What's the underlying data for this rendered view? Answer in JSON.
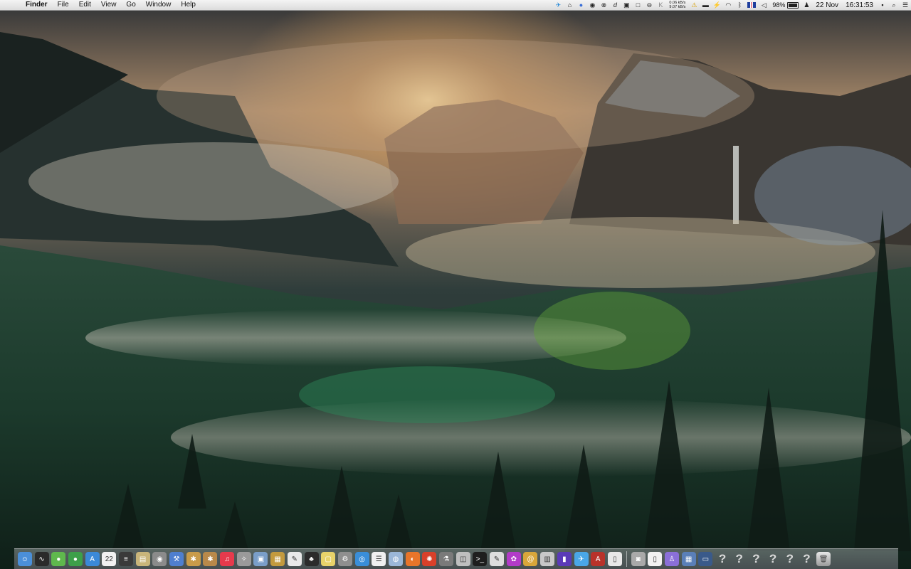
{
  "menubar": {
    "app_name": "Finder",
    "menus": [
      "File",
      "Edit",
      "View",
      "Go",
      "Window",
      "Help"
    ],
    "status_icons": [
      "twitter-icon",
      "home-icon",
      "tor-icon",
      "chrome-icon",
      "cancel-icon",
      "dash-icon",
      "display-icon",
      "square-icon",
      "clock-icon",
      "k-icon"
    ],
    "net_up": "0.06 kB/s",
    "net_down": "9.07 kB/s",
    "battery_percent": "98%",
    "battery_level": 0.98,
    "date": "22 Nov",
    "time": "16:31:53"
  },
  "dock": {
    "apps": [
      {
        "name": "finder",
        "color": "#4b8fd8",
        "glyph": "☺"
      },
      {
        "name": "activity-monitor",
        "color": "#2a2a2a",
        "glyph": "∿"
      },
      {
        "name": "messages",
        "color": "#5fb84d",
        "glyph": "●"
      },
      {
        "name": "facetime",
        "color": "#3da04a",
        "glyph": "●"
      },
      {
        "name": "app-store",
        "color": "#3b89d8",
        "glyph": "A"
      },
      {
        "name": "calendar",
        "color": "#f2f2f2",
        "glyph": "22"
      },
      {
        "name": "console",
        "color": "#3a3a3a",
        "glyph": "≡"
      },
      {
        "name": "preview",
        "color": "#c9b57a",
        "glyph": "▤"
      },
      {
        "name": "disk-utility",
        "color": "#8b8b8b",
        "glyph": "◉"
      },
      {
        "name": "xcode",
        "color": "#4f7fcf",
        "glyph": "⚒"
      },
      {
        "name": "paw-app",
        "color": "#c89b4a",
        "glyph": "✱"
      },
      {
        "name": "paw-app-2",
        "color": "#b9894a",
        "glyph": "✱"
      },
      {
        "name": "itunes",
        "color": "#e63a4c",
        "glyph": "♫"
      },
      {
        "name": "compass-app",
        "color": "#9a9a9a",
        "glyph": "✧"
      },
      {
        "name": "photo-app",
        "color": "#7a9ec8",
        "glyph": "▣"
      },
      {
        "name": "archive-app",
        "color": "#c39a3e",
        "glyph": "▦"
      },
      {
        "name": "textedit",
        "color": "#e9e9e9",
        "glyph": "✎"
      },
      {
        "name": "script-app",
        "color": "#2b2b2b",
        "glyph": "♣"
      },
      {
        "name": "stickies",
        "color": "#e8d36a",
        "glyph": "▢"
      },
      {
        "name": "system-prefs",
        "color": "#8f8f8f",
        "glyph": "⚙"
      },
      {
        "name": "safari",
        "color": "#3a8ed8",
        "glyph": "◎"
      },
      {
        "name": "notes",
        "color": "#f0f0f0",
        "glyph": "☰"
      },
      {
        "name": "network-app",
        "color": "#9bb7d8",
        "glyph": "◍"
      },
      {
        "name": "firefox",
        "color": "#e8752a",
        "glyph": "◐"
      },
      {
        "name": "red-app",
        "color": "#d8402a",
        "glyph": "✺"
      },
      {
        "name": "flask-app",
        "color": "#7a7a7a",
        "glyph": "⚗"
      },
      {
        "name": "screenshot-app",
        "color": "#bfbfbf",
        "glyph": "◫"
      },
      {
        "name": "terminal",
        "color": "#1e1e1e",
        "glyph": ">_"
      },
      {
        "name": "notes-2",
        "color": "#dedede",
        "glyph": "✎"
      },
      {
        "name": "flower-app",
        "color": "#b23bc8",
        "glyph": "✿"
      },
      {
        "name": "at-app",
        "color": "#d8a63a",
        "glyph": "@"
      },
      {
        "name": "library-app",
        "color": "#c8c8c8",
        "glyph": "▥"
      },
      {
        "name": "books-app",
        "color": "#5a3ab8",
        "glyph": "▮"
      },
      {
        "name": "twitter-app",
        "color": "#4aa7e8",
        "glyph": "✈"
      },
      {
        "name": "acrobat-app",
        "color": "#b8322a",
        "glyph": "A"
      },
      {
        "name": "doc-app",
        "color": "#e8e8e8",
        "glyph": "▯"
      }
    ],
    "docs": [
      {
        "name": "camera-doc",
        "color": "#a9a9a9",
        "glyph": "◙"
      },
      {
        "name": "file-doc",
        "color": "#f2f2f2",
        "glyph": "▯"
      },
      {
        "name": "wizard-app",
        "color": "#8a6fd8",
        "glyph": "♙"
      },
      {
        "name": "gallery-doc",
        "color": "#5a7fb8",
        "glyph": "▦"
      },
      {
        "name": "screen-doc",
        "color": "#3a5a8a",
        "glyph": "▭"
      }
    ],
    "unknown_count": 6,
    "unknown_glyph": "?"
  }
}
